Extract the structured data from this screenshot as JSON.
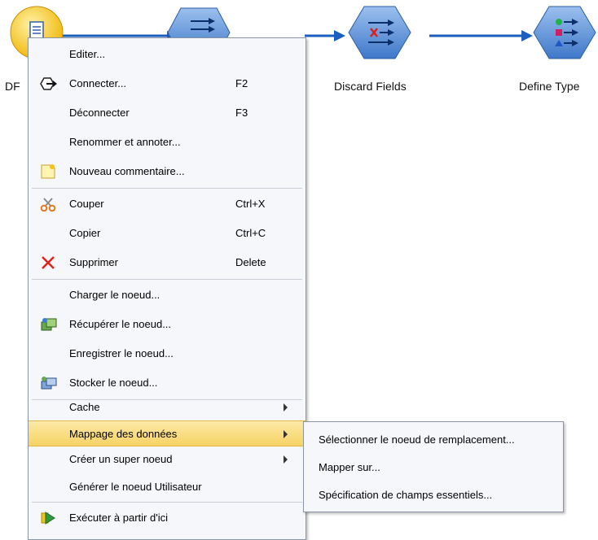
{
  "canvas": {
    "nodes": [
      {
        "label": "DF",
        "icon": "source-node-icon"
      },
      {
        "label": "",
        "icon": "transform-node-icon"
      },
      {
        "label": "Discard Fields",
        "icon": "discard-fields-icon"
      },
      {
        "label": "Define Type",
        "icon": "define-type-icon"
      }
    ]
  },
  "context_menu": {
    "items": [
      {
        "label": "Editer...",
        "shortcut": ""
      },
      {
        "label": "Connecter...",
        "shortcut": "F2",
        "icon": "connect-icon"
      },
      {
        "label": "Déconnecter",
        "shortcut": "F3"
      },
      {
        "label": "Renommer et annoter...",
        "shortcut": ""
      },
      {
        "label": "Nouveau commentaire...",
        "shortcut": "",
        "icon": "new-comment-icon"
      },
      {
        "label": "Couper",
        "shortcut": "Ctrl+X",
        "icon": "scissors-icon"
      },
      {
        "label": "Copier",
        "shortcut": "Ctrl+C"
      },
      {
        "label": "Supprimer",
        "shortcut": "Delete",
        "icon": "delete-x-icon"
      },
      {
        "label": "Charger le noeud...",
        "shortcut": ""
      },
      {
        "label": "Récupérer le noeud...",
        "shortcut": "",
        "icon": "retrieve-node-icon"
      },
      {
        "label": "Enregistrer le noeud...",
        "shortcut": ""
      },
      {
        "label": "Stocker le noeud...",
        "shortcut": "",
        "icon": "store-node-icon"
      },
      {
        "label": "Cache",
        "shortcut": "",
        "submenu": true
      },
      {
        "label": "Mappage des données",
        "shortcut": "",
        "submenu": true,
        "highlighted": true
      },
      {
        "label": "Créer un super noeud",
        "shortcut": "",
        "submenu": true
      },
      {
        "label": "Générer le noeud Utilisateur",
        "shortcut": ""
      },
      {
        "label": "Exécuter à partir d'ici",
        "shortcut": "",
        "icon": "run-from-here-icon"
      }
    ]
  },
  "submenu": {
    "items": [
      {
        "label": "Sélectionner le noeud de remplacement..."
      },
      {
        "label": "Mapper sur..."
      },
      {
        "label": "Spécification de champs essentiels..."
      }
    ]
  },
  "colors": {
    "node_blue": "#5b8fd6",
    "connector": "#1a5fc0",
    "highlight": "#f7d364"
  }
}
